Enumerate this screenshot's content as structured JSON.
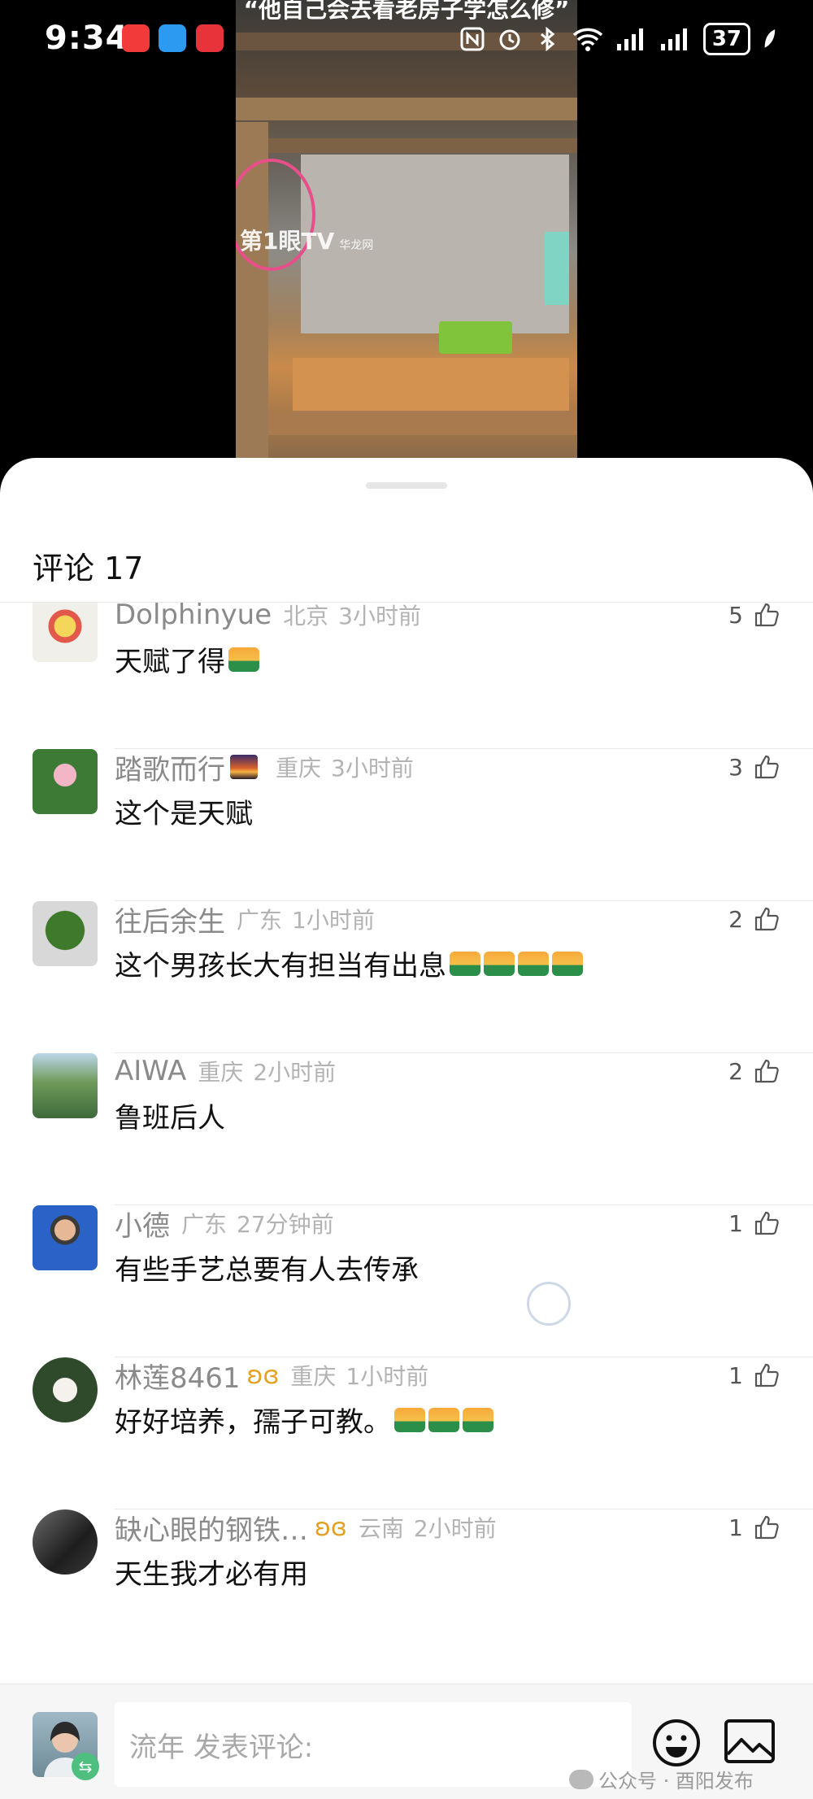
{
  "status_bar": {
    "time": "9:34",
    "battery": "37",
    "app_icon_colors": [
      "#f23a3a",
      "#2c9af0",
      "#e8333a"
    ]
  },
  "video": {
    "caption": "“他自己会去看老房子学怎么修”",
    "watermark": "第1眼TV",
    "watermark_sub": "华龙网"
  },
  "sheet": {
    "title": "评论",
    "count": "17"
  },
  "comments": [
    {
      "nickname": "Dolphinyue",
      "location": "北京",
      "time": "3小时前",
      "text": "天赋了得",
      "emoji_count": 1,
      "likes": "5"
    },
    {
      "nickname": "踏歌而行",
      "location": "重庆",
      "time": "3小时前",
      "text": "这个是天赋",
      "emoji_count": 0,
      "likes": "3"
    },
    {
      "nickname": "往后余生",
      "location": "广东",
      "time": "1小时前",
      "text": "这个男孩长大有担当有出息",
      "emoji_count": 4,
      "likes": "2"
    },
    {
      "nickname": "AIWA",
      "location": "重庆",
      "time": "2小时前",
      "text": "鲁班后人",
      "emoji_count": 0,
      "likes": "2"
    },
    {
      "nickname": "小德",
      "location": "广东",
      "time": "27分钟前",
      "text": "有些手艺总要有人去传承",
      "emoji_count": 0,
      "likes": "1"
    },
    {
      "nickname": "林莲8461",
      "location": "重庆",
      "time": "1小时前",
      "text": "好好培养，孺子可教。",
      "emoji_count": 3,
      "likes": "1"
    },
    {
      "nickname": "缺心眼的钢铁…",
      "location": "云南",
      "time": "2小时前",
      "text": "天生我才必有用",
      "emoji_count": 0,
      "likes": "1"
    }
  ],
  "composer": {
    "placeholder": "流年 发表评论:"
  },
  "footer_watermark": "公众号 · 酉阳发布"
}
